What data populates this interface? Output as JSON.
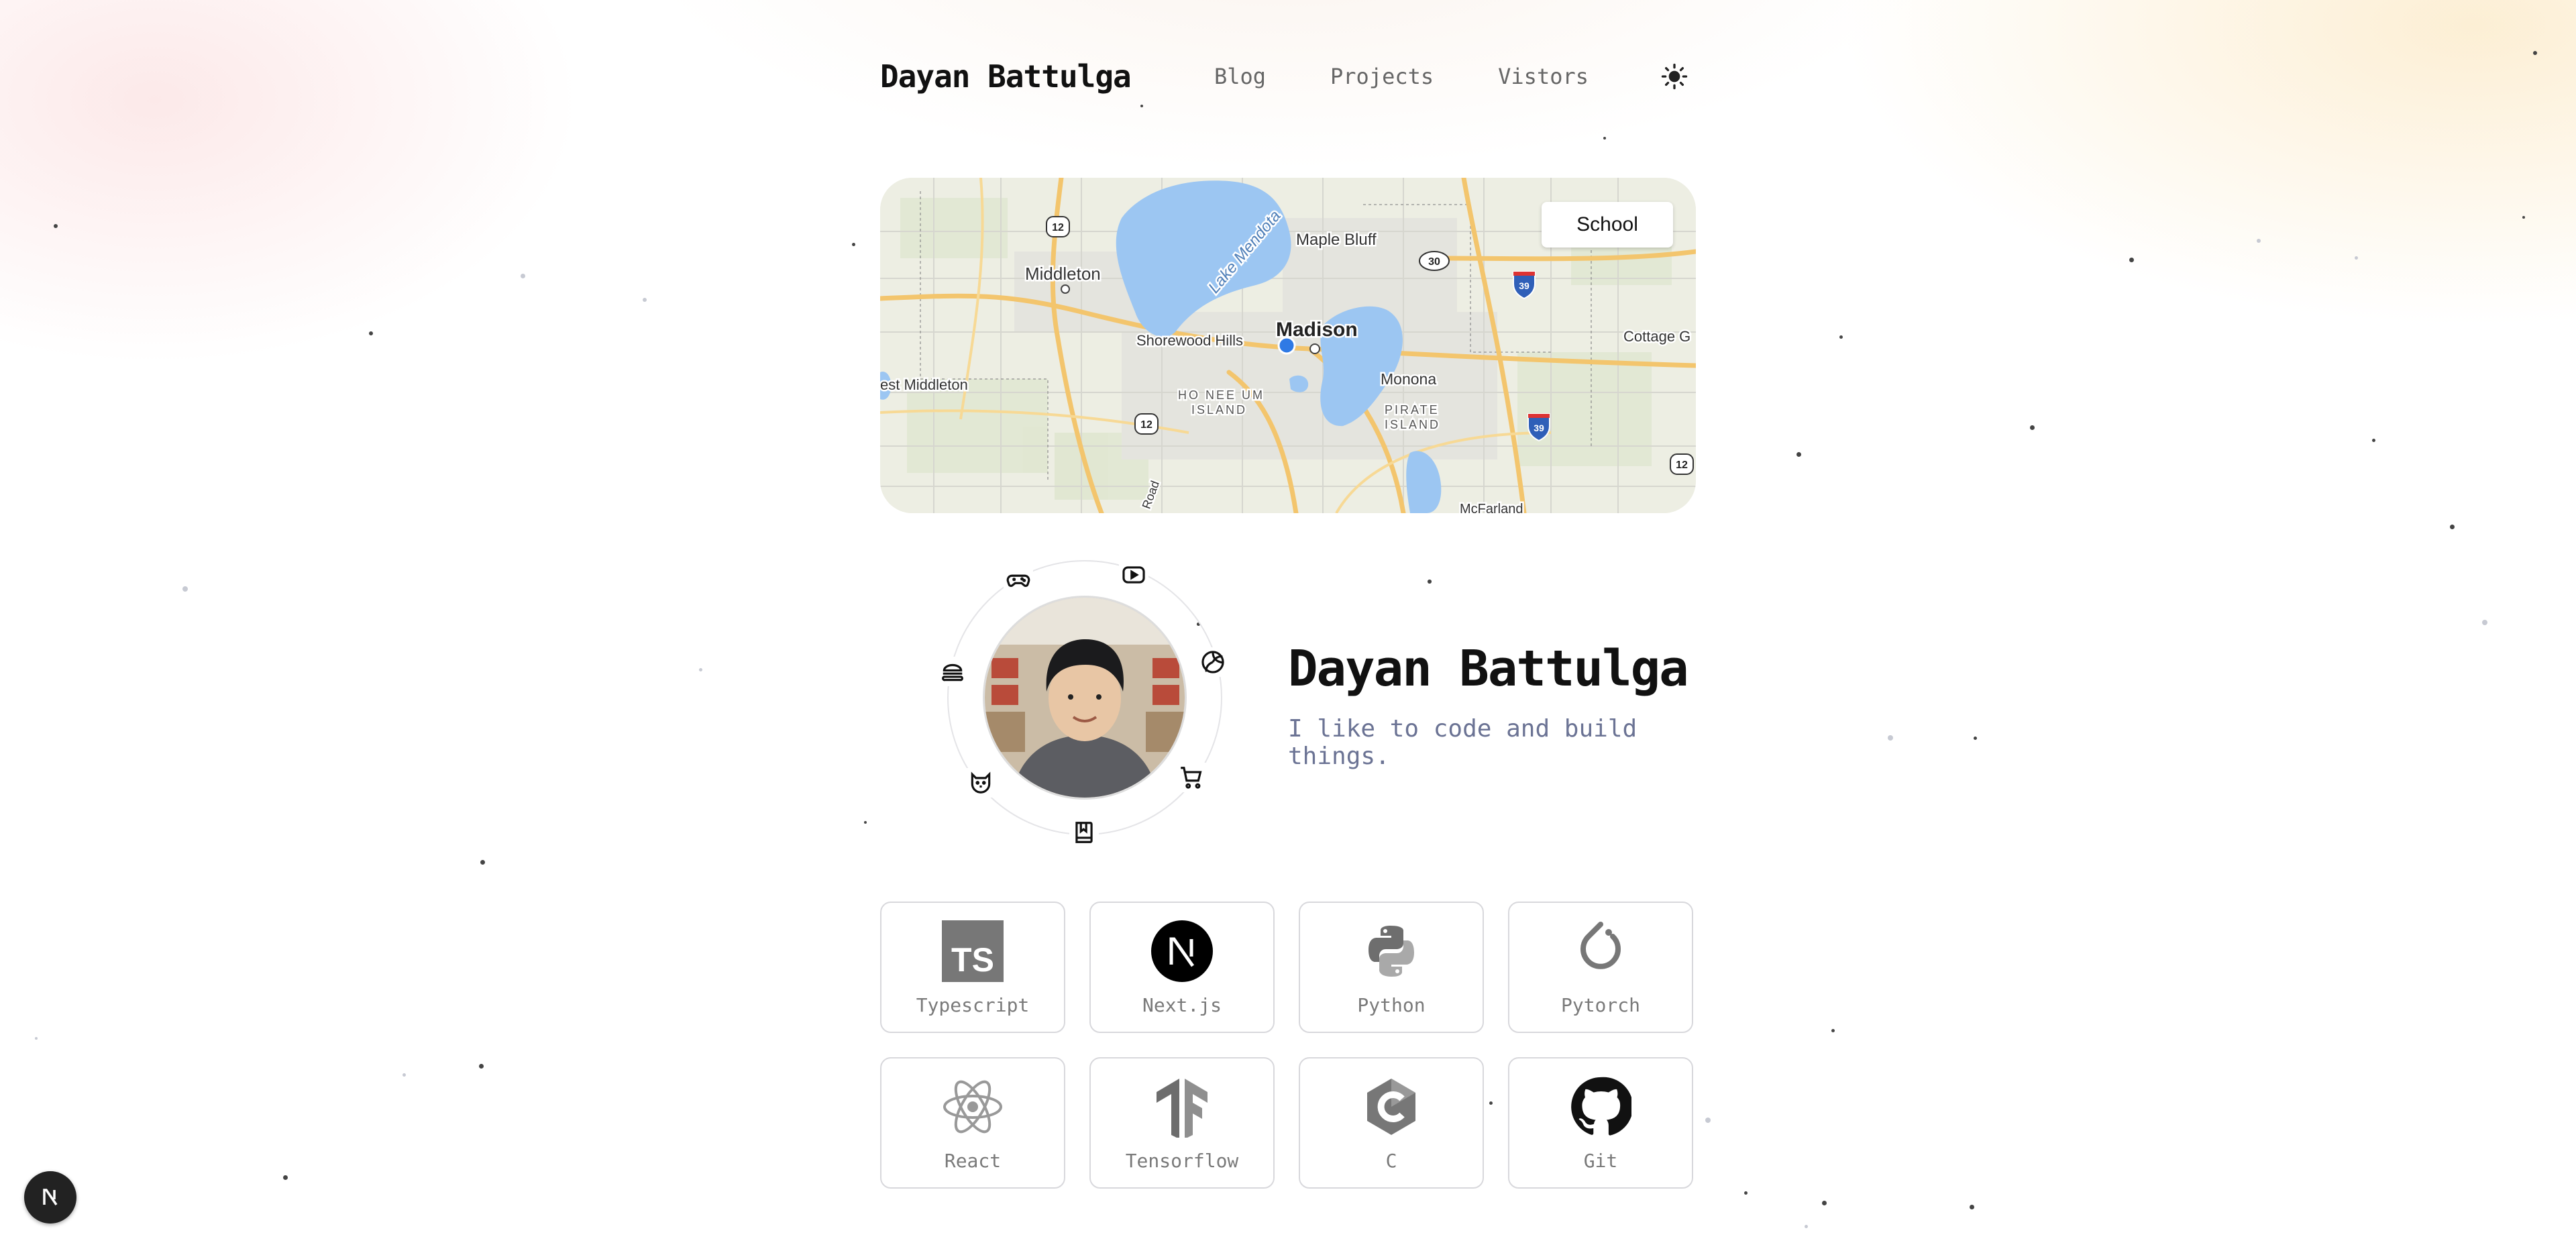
{
  "header": {
    "brand": "Dayan Battulga",
    "nav": [
      {
        "label": "Blog"
      },
      {
        "label": "Projects"
      },
      {
        "label": "Vistors"
      }
    ],
    "theme_icon": "sun-icon"
  },
  "map": {
    "button_label": "School",
    "labels": {
      "middleton": "Middleton",
      "lake": "Lake Mendota",
      "maple_bluff": "Maple Bluff",
      "shorewood": "Shorewood Hills",
      "madison": "Madison",
      "monona": "Monona",
      "west_middleton": "est Middleton",
      "ho_nee_um_1": "HO NEE UM",
      "ho_nee_um_2": "ISLAND",
      "pirate_1": "PIRATE",
      "pirate_2": "ISLAND",
      "cottage": "Cottage G",
      "road": "Road",
      "mcfarland": "McFarland"
    },
    "shields": {
      "us12": "12",
      "wi30": "30",
      "i39": "39"
    }
  },
  "profile": {
    "name": "Dayan Battulga",
    "tagline": "I like to code and build things.",
    "avatar_icon": "avatar-photo",
    "orbit_icons": [
      "gamepad-icon",
      "youtube-icon",
      "volleyball-icon",
      "shopping-cart-icon",
      "book-icon",
      "cat-icon",
      "burger-icon"
    ]
  },
  "tech": [
    {
      "label": "Typescript",
      "icon": "typescript-icon"
    },
    {
      "label": "Next.js",
      "icon": "nextjs-icon"
    },
    {
      "label": "Python",
      "icon": "python-icon"
    },
    {
      "label": "Pytorch",
      "icon": "pytorch-icon"
    },
    {
      "label": "React",
      "icon": "react-icon"
    },
    {
      "label": "Tensorflow",
      "icon": "tensorflow-icon"
    },
    {
      "label": "C",
      "icon": "c-icon"
    },
    {
      "label": "Git",
      "icon": "github-icon"
    }
  ],
  "fab": {
    "letter": "N",
    "icon": "nextjs-devtools-icon"
  },
  "colors": {
    "accent_text": "#6b7394",
    "water": "#9cc6f2",
    "road": "#f4c56a"
  }
}
